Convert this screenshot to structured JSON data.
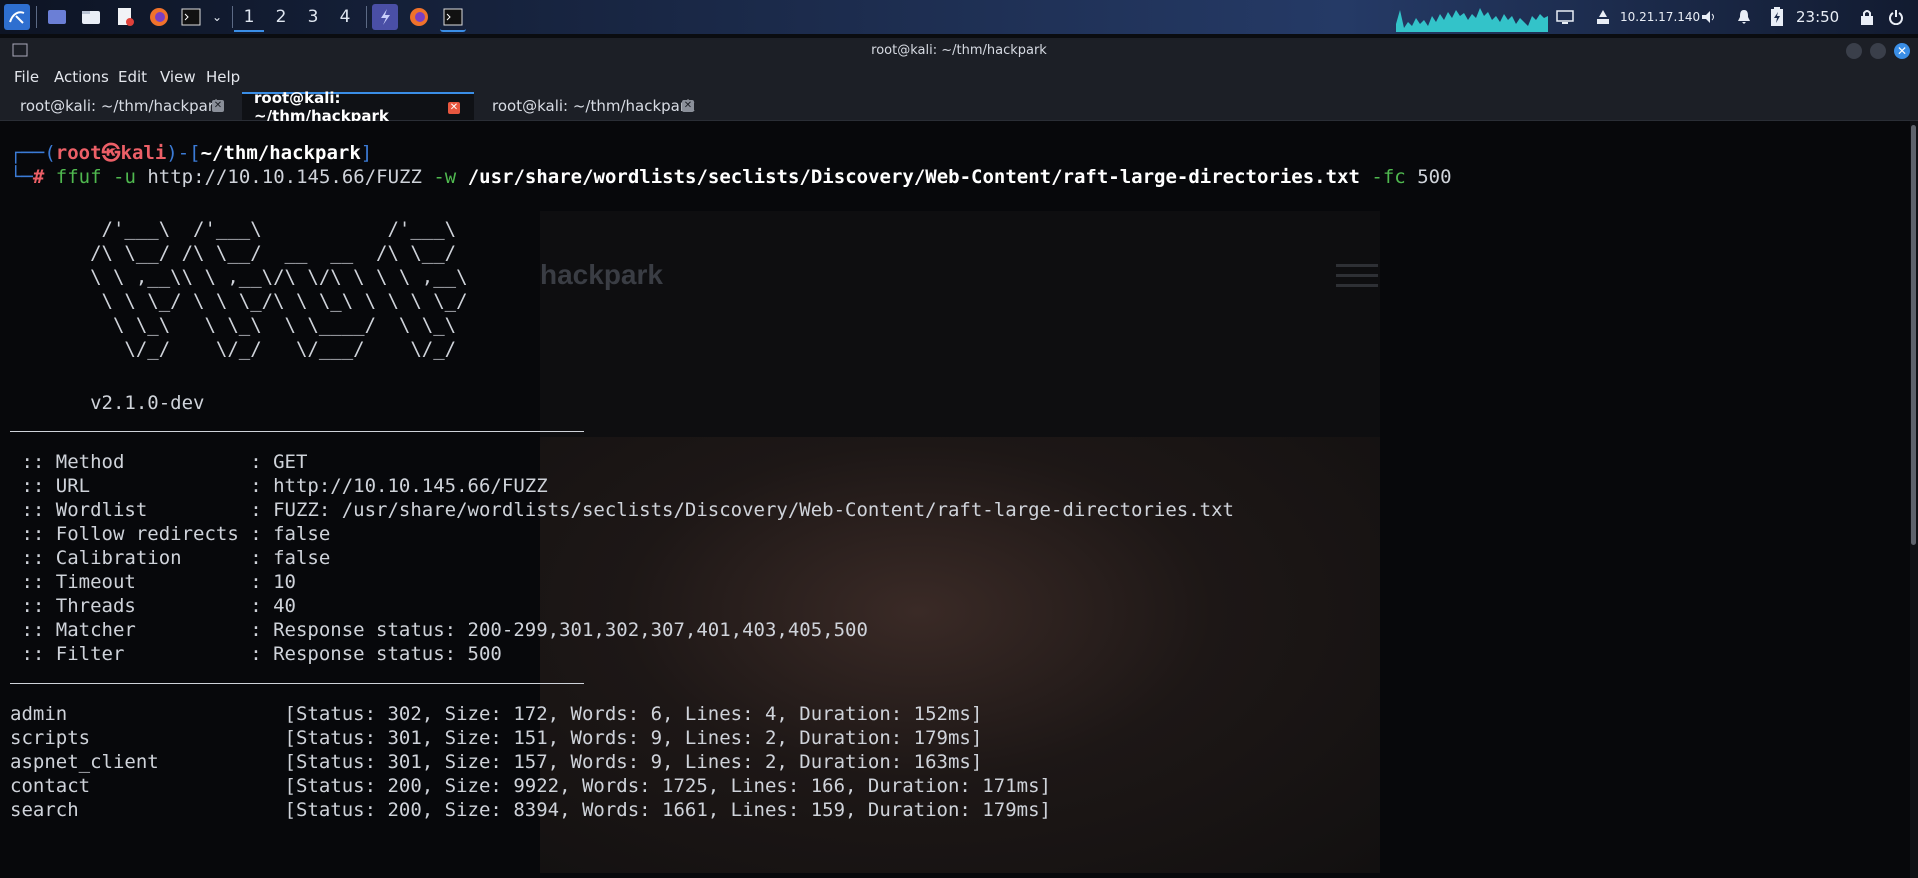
{
  "taskbar": {
    "workspaces": [
      "1",
      "2",
      "3",
      "4"
    ],
    "active_workspace": "1",
    "ip": "10.21.17.140",
    "clock": "23:50",
    "apps": [
      "kali-menu-icon",
      "desktop-icon",
      "file-manager-icon",
      "text-editor-icon",
      "firefox-icon",
      "terminal-icon"
    ]
  },
  "window": {
    "title": "root@kali: ~/thm/hackpark",
    "menu": [
      "File",
      "Actions",
      "Edit",
      "View",
      "Help"
    ],
    "tabs": [
      {
        "label": "root@kali: ~/thm/hackpark",
        "active": false
      },
      {
        "label": "root@kali: ~/thm/hackpark",
        "active": true
      },
      {
        "label": "root@kali: ~/thm/hackpark",
        "active": false
      }
    ]
  },
  "terminal": {
    "prompt_user": "root㉿kali",
    "prompt_path": "~/thm/hackpark",
    "cmd_name": "ffuf",
    "cmd_u": "-u",
    "cmd_url": "http://10.10.145.66/FUZZ",
    "cmd_w": "-w",
    "cmd_wordlist": "/usr/share/wordlists/seclists/Discovery/Web-Content/raft-large-directories.txt",
    "cmd_fc": "-fc",
    "cmd_fc_val": "500",
    "banner": [
      "        /'___\\  /'___\\           /'___\\       ",
      "       /\\ \\__/ /\\ \\__/  __  __  /\\ \\__/       ",
      "       \\ \\ ,__\\\\ \\ ,__\\/\\ \\/\\ \\ \\ \\ ,__\\      ",
      "        \\ \\ \\_/ \\ \\ \\_/\\ \\ \\_\\ \\ \\ \\ \\_/      ",
      "         \\ \\_\\   \\ \\_\\  \\ \\____/  \\ \\_\\       ",
      "          \\/_/    \\/_/   \\/___/    \\/_/       "
    ],
    "version": "       v2.1.0-dev",
    "config": [
      " :: Method           : GET",
      " :: URL              : http://10.10.145.66/FUZZ",
      " :: Wordlist         : FUZZ: /usr/share/wordlists/seclists/Discovery/Web-Content/raft-large-directories.txt",
      " :: Follow redirects : false",
      " :: Calibration      : false",
      " :: Timeout          : 10",
      " :: Threads          : 40",
      " :: Matcher          : Response status: 200-299,301,302,307,401,403,405,500",
      " :: Filter           : Response status: 500"
    ],
    "results": [
      "admin                   [Status: 302, Size: 172, Words: 6, Lines: 4, Duration: 152ms]",
      "scripts                 [Status: 301, Size: 151, Words: 9, Lines: 2, Duration: 179ms]",
      "aspnet_client           [Status: 301, Size: 157, Words: 9, Lines: 2, Duration: 163ms]",
      "contact                 [Status: 200, Size: 9922, Words: 1725, Lines: 166, Duration: 171ms]",
      "search                  [Status: 200, Size: 8394, Words: 1661, Lines: 159, Duration: 179ms]"
    ]
  },
  "background_page": {
    "title": "hackpark"
  },
  "colors": {
    "accent": "#3a8ee6",
    "prompt_red": "#ec5f67",
    "prompt_blue": "#3b7bd6",
    "flag_green": "#4fb84f"
  }
}
